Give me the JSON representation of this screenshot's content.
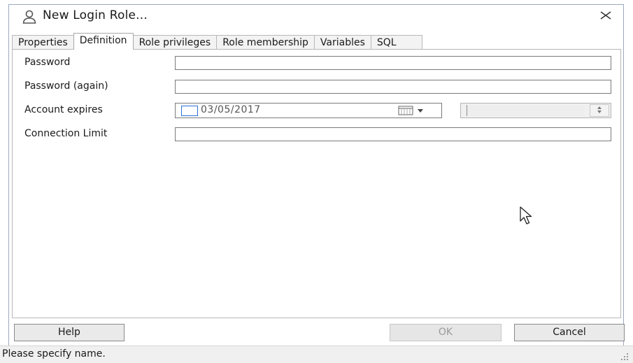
{
  "window": {
    "title": "New Login Role...",
    "title_icon": "user-icon",
    "close_icon": "close-icon",
    "close_glyph": "✕"
  },
  "tabs": [
    {
      "label": "Properties",
      "active": false
    },
    {
      "label": "Definition",
      "active": true
    },
    {
      "label": "Role privileges",
      "active": false
    },
    {
      "label": "Role membership",
      "active": false
    },
    {
      "label": "Variables",
      "active": false
    },
    {
      "label": "SQL",
      "active": false
    }
  ],
  "definition": {
    "password_label": "Password",
    "password_value": "",
    "password_again_label": "Password (again)",
    "password_again_value": "",
    "account_expires_label": "Account expires",
    "account_expires_date": "03/05/2017",
    "account_expires_checked": false,
    "account_expires_time": "",
    "connection_limit_label": "Connection Limit",
    "connection_limit_value": ""
  },
  "buttons": {
    "help": "Help",
    "ok": "OK",
    "cancel": "Cancel"
  },
  "status": {
    "message": "Please specify name."
  },
  "colors": {
    "accent": "#2a6fd6",
    "border": "#9aa8bc"
  }
}
